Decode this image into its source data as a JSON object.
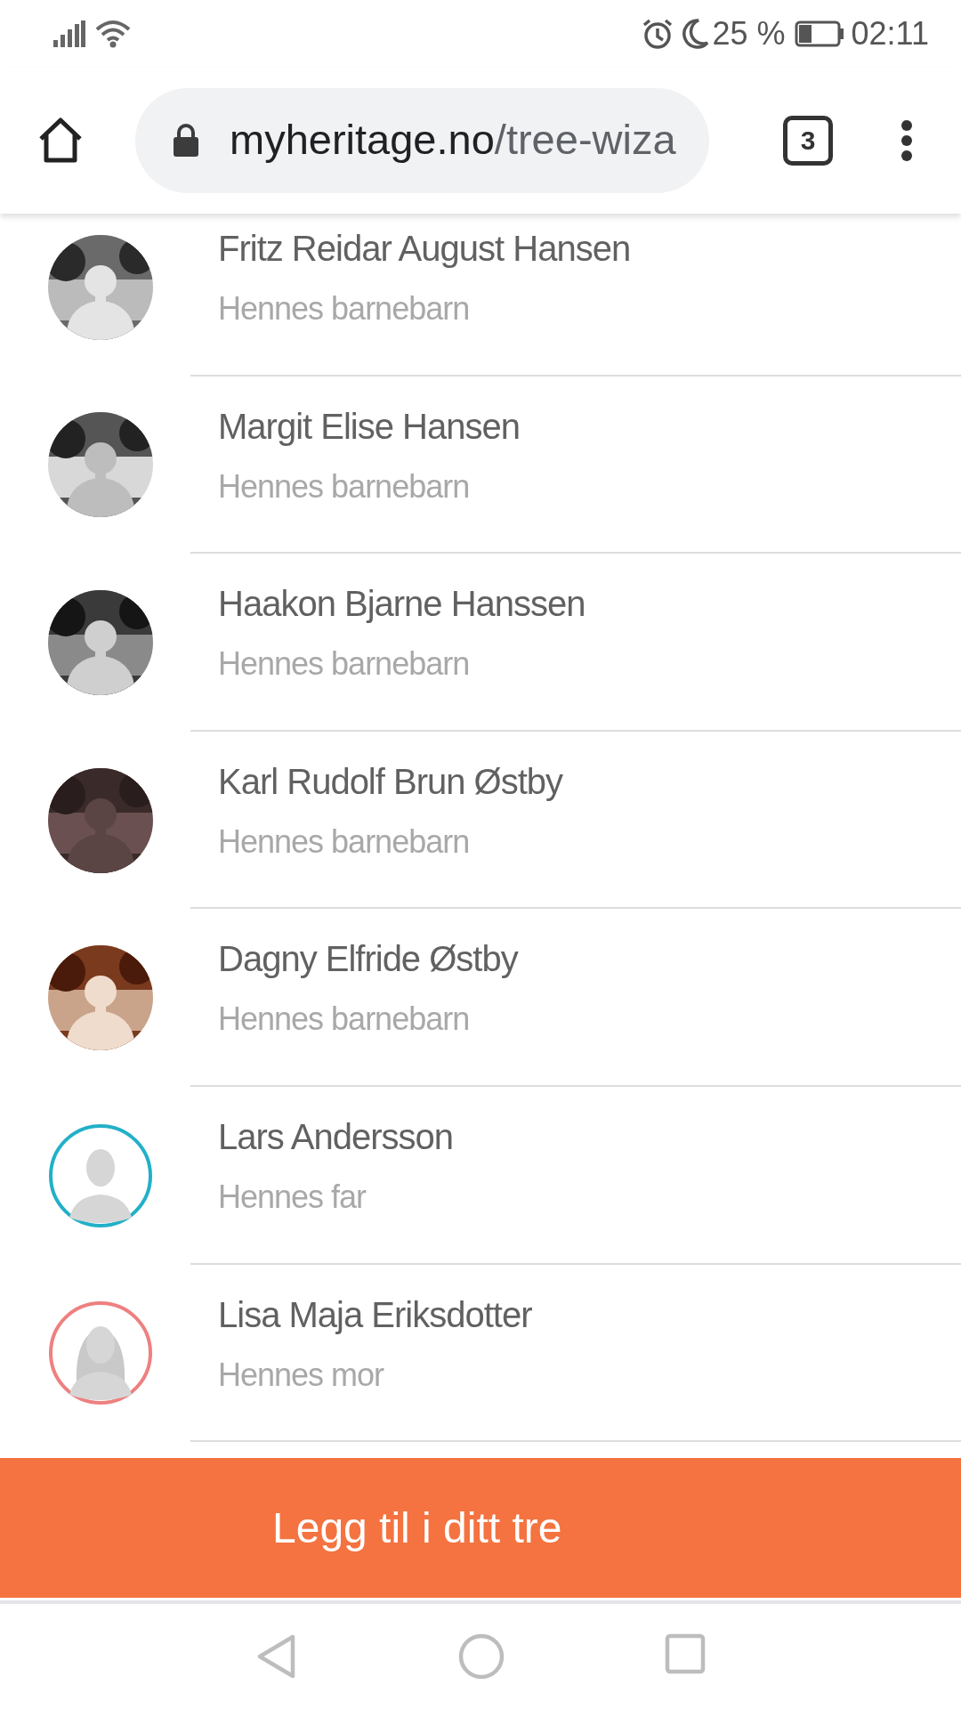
{
  "status_bar": {
    "battery_text": "25 %",
    "time": "02:11"
  },
  "browser_bar": {
    "url_host": "myheritage.no",
    "url_path": "/tree-wiza",
    "tab_count": "3"
  },
  "people": [
    {
      "name": "Fritz Reidar August Hansen",
      "relation": "Hennes barnebarn"
    },
    {
      "name": "Margit Elise Hansen",
      "relation": "Hennes barnebarn"
    },
    {
      "name": "Haakon Bjarne Hanssen",
      "relation": "Hennes barnebarn"
    },
    {
      "name": "Karl Rudolf Brun Østby",
      "relation": "Hennes barnebarn"
    },
    {
      "name": "Dagny Elfride Østby",
      "relation": "Hennes barnebarn"
    },
    {
      "name": "Lars Andersson",
      "relation": "Hennes far",
      "kind": "male",
      "color": "#22b0c8"
    },
    {
      "name": "Lisa Maja Eriksdotter",
      "relation": "Hennes mor",
      "kind": "female",
      "color": "#ee8080"
    }
  ],
  "add_button": {
    "label": "Legg til i ditt tre"
  }
}
